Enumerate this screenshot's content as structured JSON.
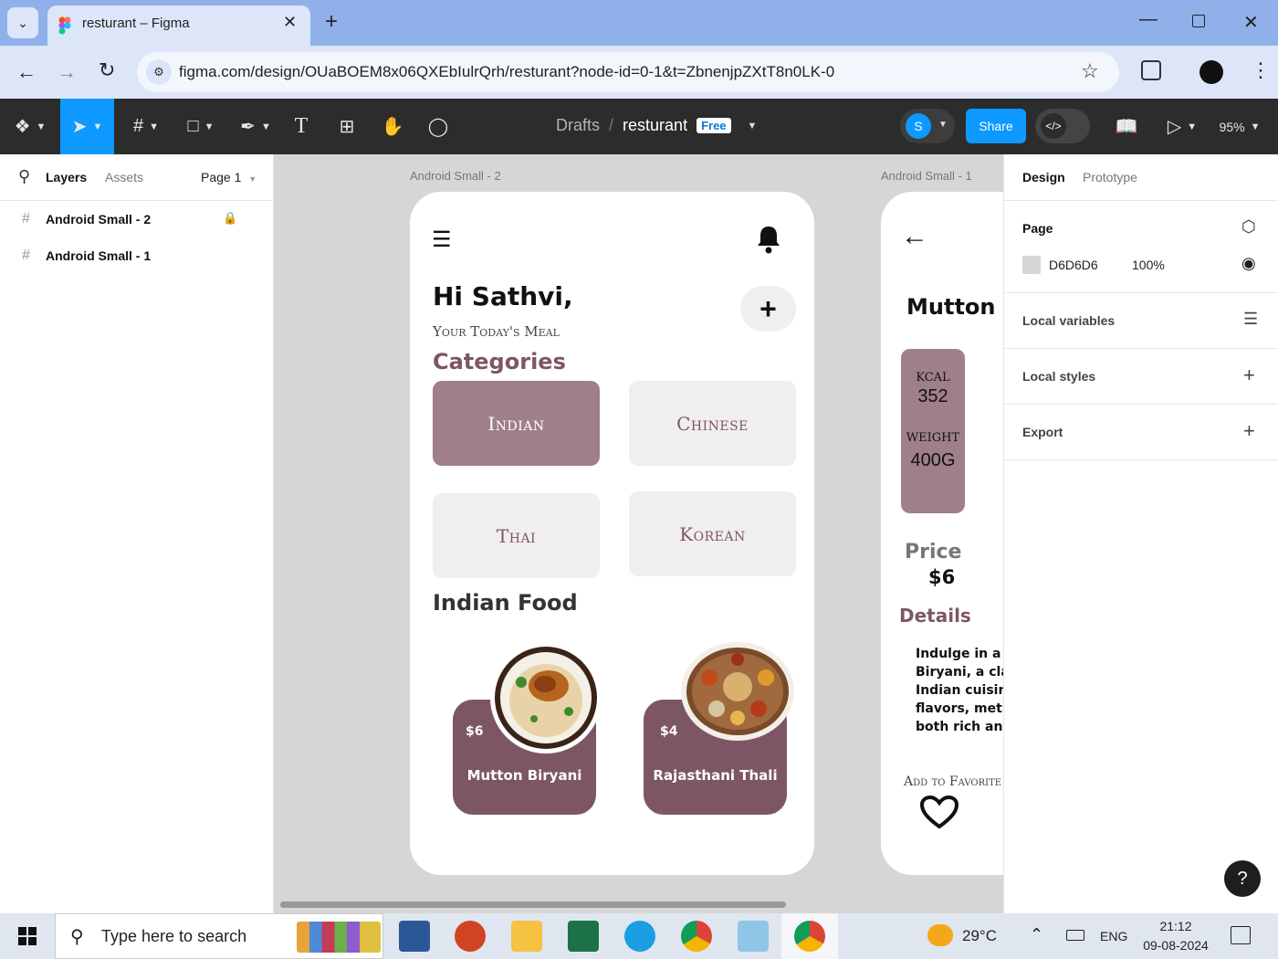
{
  "browser": {
    "tab_title": "resturant – Figma",
    "url": "figma.com/design/OUaBOEM8x06QXEbIulrQrh/resturant?node-id=0-1&t=ZbnenjpZXtT8n0LK-0"
  },
  "toolbar": {
    "breadcrumb_root": "Drafts",
    "breadcrumb_sep": "/",
    "file_name": "resturant",
    "plan_badge": "Free",
    "avatar_initial": "S",
    "share_label": "Share",
    "zoom": "95%"
  },
  "left_panel": {
    "tabs": [
      "Layers",
      "Assets"
    ],
    "page_selector": "Page 1",
    "layers": [
      {
        "name": "Android Small - 2",
        "locked": true
      },
      {
        "name": "Android Small - 1",
        "locked": false
      }
    ]
  },
  "right_panel": {
    "tabs": [
      "Design",
      "Prototype"
    ],
    "page_section": "Page",
    "bg_color_hex": "D6D6D6",
    "bg_opacity": "100%",
    "local_variables": "Local variables",
    "local_styles": "Local styles",
    "export": "Export",
    "help": "?"
  },
  "canvas": {
    "frame2": {
      "label": "Android Small - 2",
      "greeting": "Hi Sathvi,",
      "subtitle": "Your Today's Meal",
      "categories_title": "Categories",
      "categories": [
        "Indian",
        "Chinese",
        "Thai",
        "Korean"
      ],
      "section_title": "Indian Food",
      "items": [
        {
          "price": "$6",
          "name": "Mutton Biryani"
        },
        {
          "price": "$4",
          "name": "Rajasthani Thali"
        }
      ]
    },
    "frame1": {
      "label": "Android Small - 1",
      "title": "Mutton B",
      "kcal_label": "KCAL",
      "kcal_value": "352",
      "weight_label": "WEIGHT",
      "weight_value": "400G",
      "price_label": "Price",
      "price_value": "$6",
      "details_title": "Details",
      "details_lines": [
        "Indulge in a ro",
        "Biryani, a class",
        "Indian cuisine.",
        "flavors, meticu",
        "both rich and c"
      ],
      "favorite_label": "Add to Favorite"
    }
  },
  "taskbar": {
    "search_placeholder": "Type here to search",
    "temperature": "29°C",
    "language": "ENG",
    "time": "21:12",
    "date": "09-08-2024"
  },
  "colors": {
    "accent": "#0d99ff",
    "card": "#7d5665",
    "category_selected": "#9f7f89",
    "category_idle": "#f1eef2"
  }
}
